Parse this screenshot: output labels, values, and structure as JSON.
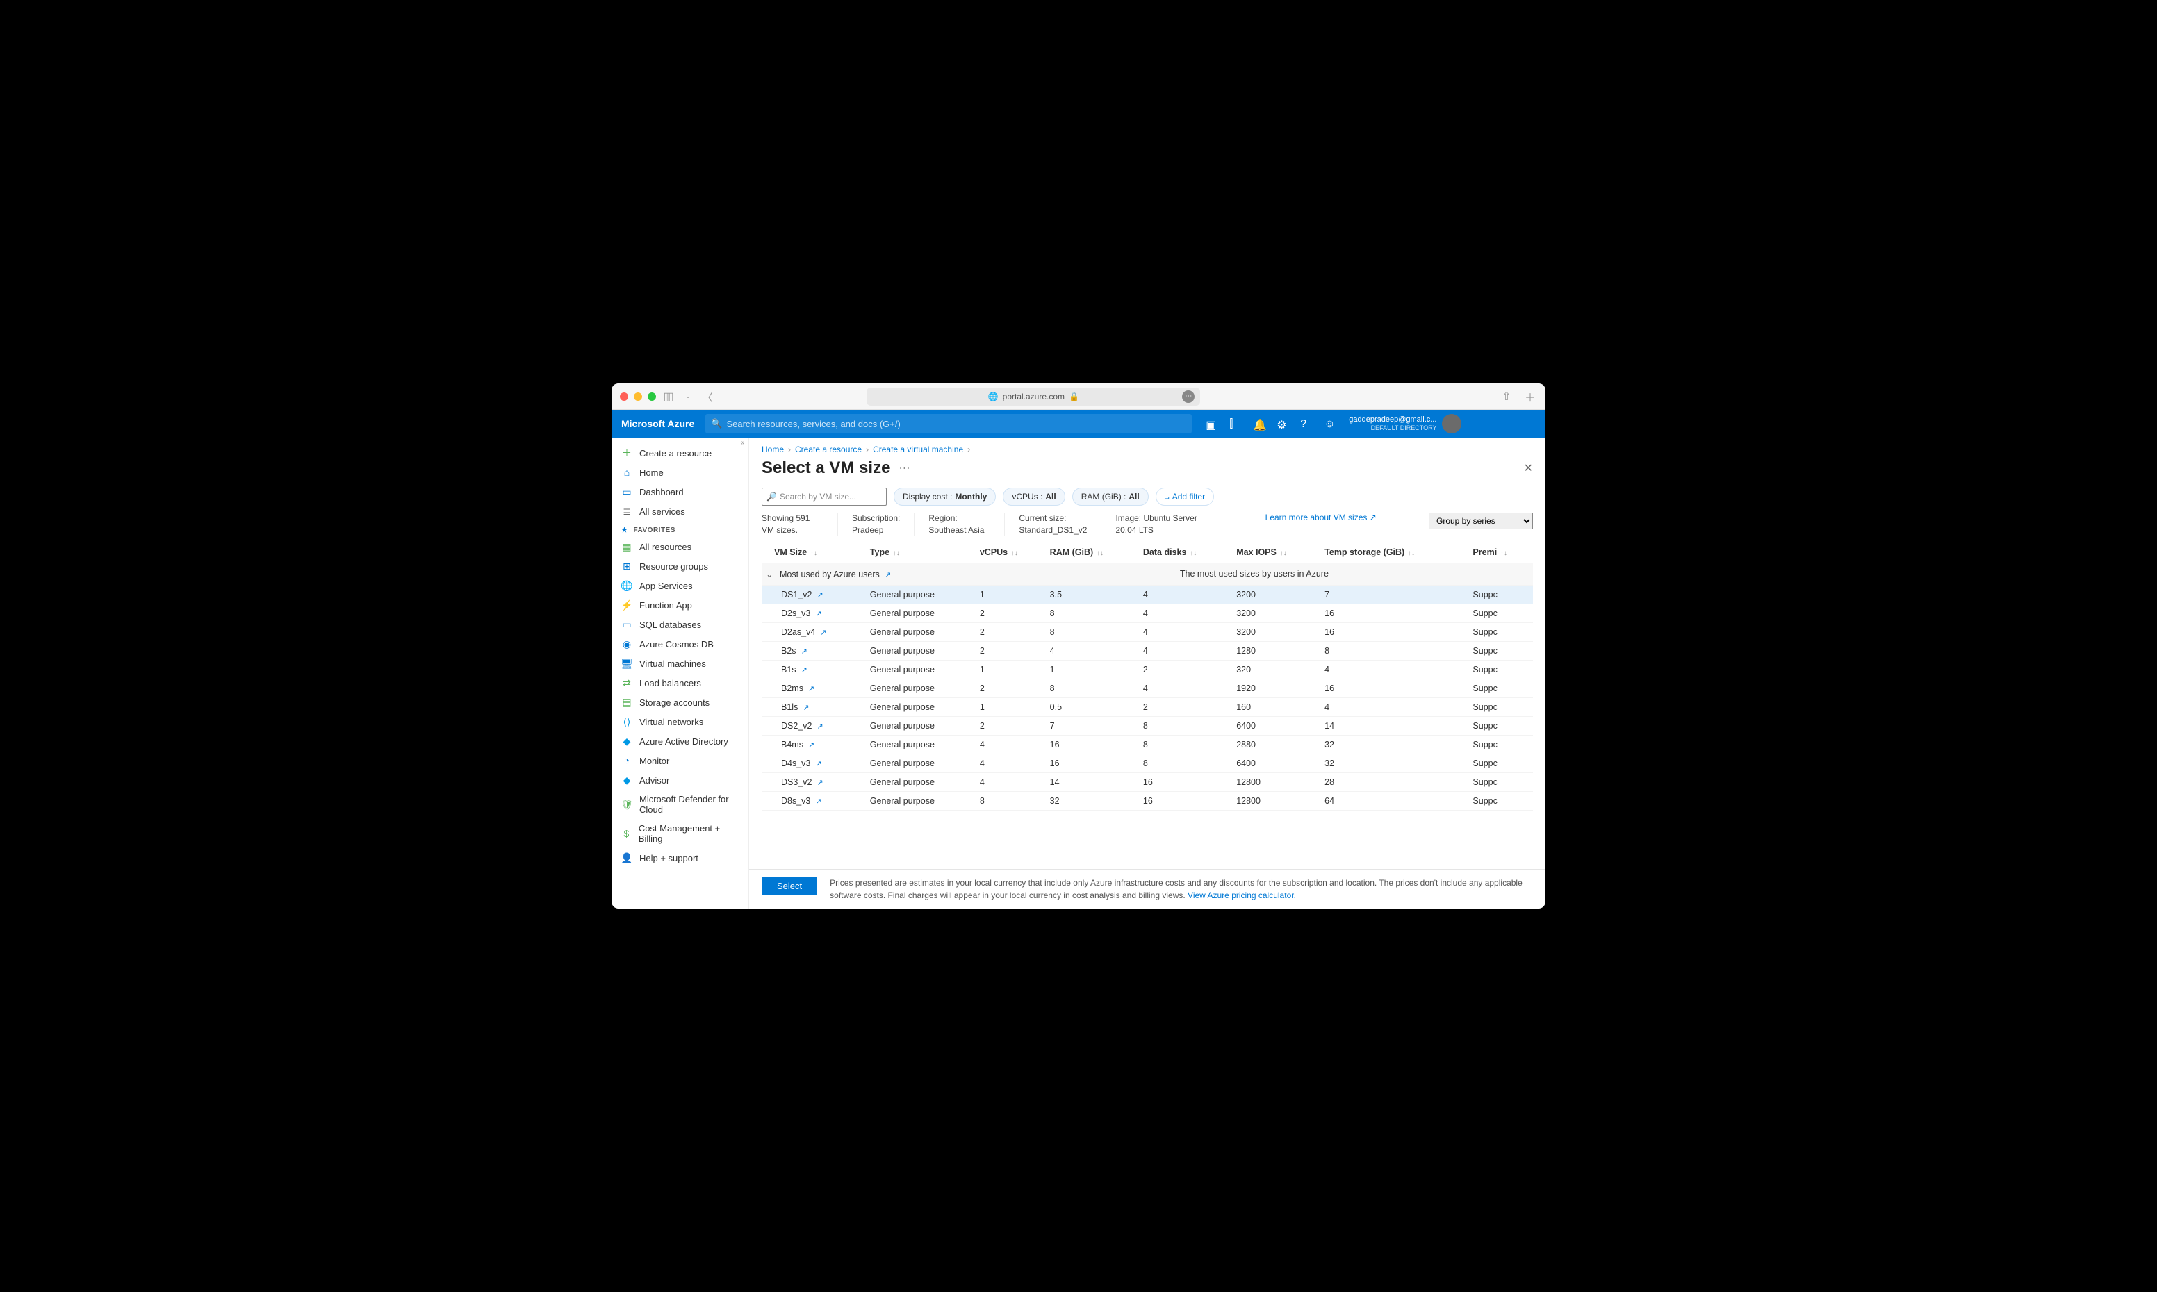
{
  "browser": {
    "url_host": "portal.azure.com"
  },
  "topbar": {
    "brand": "Microsoft Azure",
    "search_placeholder": "Search resources, services, and docs (G+/)",
    "user_email": "gaddepradeep@gmail.c...",
    "user_dir": "DEFAULT DIRECTORY"
  },
  "sidebar": {
    "items_top": [
      {
        "label": "Create a resource",
        "icon": "＋",
        "color": "#5bb55b"
      },
      {
        "label": "Home",
        "icon": "⌂",
        "color": "#0078d4"
      },
      {
        "label": "Dashboard",
        "icon": "▭",
        "color": "#0078d4"
      },
      {
        "label": "All services",
        "icon": "≣",
        "color": "#666"
      }
    ],
    "favorites_label": "FAVORITES",
    "favorites": [
      {
        "label": "All resources",
        "icon": "▦",
        "color": "#5bb55b"
      },
      {
        "label": "Resource groups",
        "icon": "⊞",
        "color": "#0078d4"
      },
      {
        "label": "App Services",
        "icon": "🌐",
        "color": "#0099e5"
      },
      {
        "label": "Function App",
        "icon": "⚡",
        "color": "#f0a30a"
      },
      {
        "label": "SQL databases",
        "icon": "▭",
        "color": "#0078d4"
      },
      {
        "label": "Azure Cosmos DB",
        "icon": "◉",
        "color": "#0078d4"
      },
      {
        "label": "Virtual machines",
        "icon": "🖥",
        "color": "#0078d4"
      },
      {
        "label": "Load balancers",
        "icon": "⇄",
        "color": "#5bb55b"
      },
      {
        "label": "Storage accounts",
        "icon": "▤",
        "color": "#5bb55b"
      },
      {
        "label": "Virtual networks",
        "icon": "⟨⟩",
        "color": "#0099e5"
      },
      {
        "label": "Azure Active Directory",
        "icon": "◆",
        "color": "#0099e5"
      },
      {
        "label": "Monitor",
        "icon": "◔",
        "color": "#0078d4"
      },
      {
        "label": "Advisor",
        "icon": "◆",
        "color": "#0099e5"
      },
      {
        "label": "Microsoft Defender for Cloud",
        "icon": "🛡",
        "color": "#5bb55b"
      },
      {
        "label": "Cost Management + Billing",
        "icon": "$",
        "color": "#5bb55b"
      },
      {
        "label": "Help + support",
        "icon": "👤",
        "color": "#0099e5"
      }
    ]
  },
  "crumbs": [
    "Home",
    "Create a resource",
    "Create a virtual machine"
  ],
  "page_title": "Select a VM size",
  "filters": {
    "search_placeholder": "Search by VM size...",
    "cost_label": "Display cost : ",
    "cost_value": "Monthly",
    "vcpu_label": "vCPUs : ",
    "vcpu_value": "All",
    "ram_label": "RAM (GiB) : ",
    "ram_value": "All",
    "add_filter_label": "Add filter"
  },
  "meta": {
    "showing": "Showing 591 VM sizes.",
    "subscription_label": "Subscription:",
    "subscription_value": "Pradeep",
    "region_label": "Region: Southeast Asia",
    "current_label": "Current size:",
    "current_value": "Standard_DS1_v2",
    "image_label": "Image: Ubuntu Server 20.04 LTS",
    "learn_link": "Learn more about VM sizes",
    "group_by": "Group by series"
  },
  "columns": [
    "VM Size",
    "Type",
    "vCPUs",
    "RAM (GiB)",
    "Data disks",
    "Max IOPS",
    "Temp storage (GiB)",
    "Premi"
  ],
  "group_header": {
    "name": "Most used by Azure users",
    "desc": "The most used sizes by users in Azure"
  },
  "rows": [
    {
      "size": "DS1_v2",
      "type": "General purpose",
      "vcpus": "1",
      "ram": "3.5",
      "disks": "4",
      "iops": "3200",
      "temp": "7",
      "prem": "Suppc",
      "selected": true
    },
    {
      "size": "D2s_v3",
      "type": "General purpose",
      "vcpus": "2",
      "ram": "8",
      "disks": "4",
      "iops": "3200",
      "temp": "16",
      "prem": "Suppc"
    },
    {
      "size": "D2as_v4",
      "type": "General purpose",
      "vcpus": "2",
      "ram": "8",
      "disks": "4",
      "iops": "3200",
      "temp": "16",
      "prem": "Suppc"
    },
    {
      "size": "B2s",
      "type": "General purpose",
      "vcpus": "2",
      "ram": "4",
      "disks": "4",
      "iops": "1280",
      "temp": "8",
      "prem": "Suppc"
    },
    {
      "size": "B1s",
      "type": "General purpose",
      "vcpus": "1",
      "ram": "1",
      "disks": "2",
      "iops": "320",
      "temp": "4",
      "prem": "Suppc"
    },
    {
      "size": "B2ms",
      "type": "General purpose",
      "vcpus": "2",
      "ram": "8",
      "disks": "4",
      "iops": "1920",
      "temp": "16",
      "prem": "Suppc"
    },
    {
      "size": "B1ls",
      "type": "General purpose",
      "vcpus": "1",
      "ram": "0.5",
      "disks": "2",
      "iops": "160",
      "temp": "4",
      "prem": "Suppc"
    },
    {
      "size": "DS2_v2",
      "type": "General purpose",
      "vcpus": "2",
      "ram": "7",
      "disks": "8",
      "iops": "6400",
      "temp": "14",
      "prem": "Suppc"
    },
    {
      "size": "B4ms",
      "type": "General purpose",
      "vcpus": "4",
      "ram": "16",
      "disks": "8",
      "iops": "2880",
      "temp": "32",
      "prem": "Suppc"
    },
    {
      "size": "D4s_v3",
      "type": "General purpose",
      "vcpus": "4",
      "ram": "16",
      "disks": "8",
      "iops": "6400",
      "temp": "32",
      "prem": "Suppc"
    },
    {
      "size": "DS3_v2",
      "type": "General purpose",
      "vcpus": "4",
      "ram": "14",
      "disks": "16",
      "iops": "12800",
      "temp": "28",
      "prem": "Suppc"
    },
    {
      "size": "D8s_v3",
      "type": "General purpose",
      "vcpus": "8",
      "ram": "32",
      "disks": "16",
      "iops": "12800",
      "temp": "64",
      "prem": "Suppc"
    }
  ],
  "footer": {
    "select_label": "Select",
    "note": "Prices presented are estimates in your local currency that include only Azure infrastructure costs and any discounts for the subscription and location. The prices don't include any applicable software costs. Final charges will appear in your local currency in cost analysis and billing views. ",
    "link": "View Azure pricing calculator."
  }
}
